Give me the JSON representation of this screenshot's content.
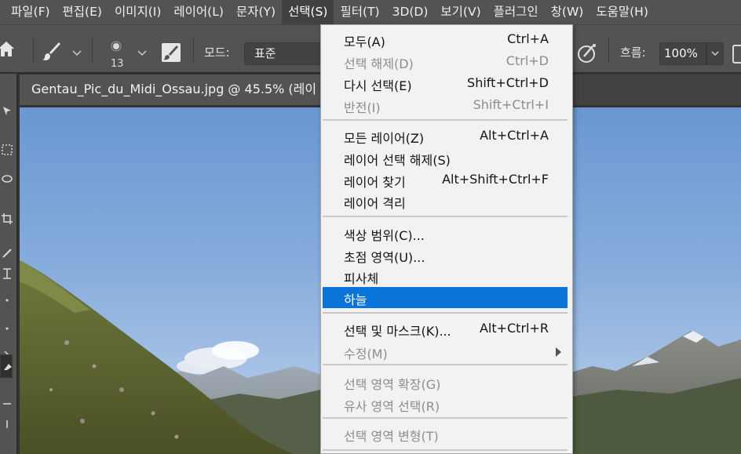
{
  "menubar": {
    "items": [
      "파일(F)",
      "편집(E)",
      "이미지(I)",
      "레이어(L)",
      "문자(Y)",
      "선택(S)",
      "필터(T)",
      "3D(D)",
      "보기(V)",
      "플러그인",
      "창(W)",
      "도움말(H)"
    ]
  },
  "options": {
    "brush_size": "13",
    "mode_label": "모드:",
    "mode_value": "표준",
    "flow_label": "흐름:",
    "flow_value": "100%"
  },
  "document": {
    "tab_title": "Gentau_Pic_du_Midi_Ossau.jpg @ 45.5% (레이"
  },
  "select_menu": {
    "groups": [
      [
        {
          "label": "모두(A)",
          "shortcut": "Ctrl+A",
          "disabled": false
        },
        {
          "label": "선택 해제(D)",
          "shortcut": "Ctrl+D",
          "disabled": true
        },
        {
          "label": "다시 선택(E)",
          "shortcut": "Shift+Ctrl+D",
          "disabled": false
        },
        {
          "label": "반전(I)",
          "shortcut": "Shift+Ctrl+I",
          "disabled": true
        }
      ],
      [
        {
          "label": "모든 레이어(Z)",
          "shortcut": "Alt+Ctrl+A",
          "disabled": false
        },
        {
          "label": "레이어 선택 해제(S)",
          "shortcut": "",
          "disabled": false
        },
        {
          "label": "레이어 찾기",
          "shortcut": "Alt+Shift+Ctrl+F",
          "disabled": false
        },
        {
          "label": "레이어 격리",
          "shortcut": "",
          "disabled": false
        }
      ],
      [
        {
          "label": "색상 범위(C)...",
          "shortcut": "",
          "disabled": false
        },
        {
          "label": "초점 영역(U)...",
          "shortcut": "",
          "disabled": false
        },
        {
          "label": "피사체",
          "shortcut": "",
          "disabled": false
        },
        {
          "label": "하늘",
          "shortcut": "",
          "disabled": false,
          "highlighted": true
        }
      ],
      [
        {
          "label": "선택 및 마스크(K)...",
          "shortcut": "Alt+Ctrl+R",
          "disabled": false
        },
        {
          "label": "수정(M)",
          "shortcut": "",
          "disabled": true,
          "submenu": true
        }
      ],
      [
        {
          "label": "선택 영역 확장(G)",
          "shortcut": "",
          "disabled": true
        },
        {
          "label": "유사 영역 선택(R)",
          "shortcut": "",
          "disabled": true
        }
      ],
      [
        {
          "label": "선택 영역 변형(T)",
          "shortcut": "",
          "disabled": true
        }
      ]
    ]
  },
  "colors": {
    "highlight": "#0a74d8",
    "menubar_bg": "#535353",
    "canvas_bg": "#323232"
  }
}
